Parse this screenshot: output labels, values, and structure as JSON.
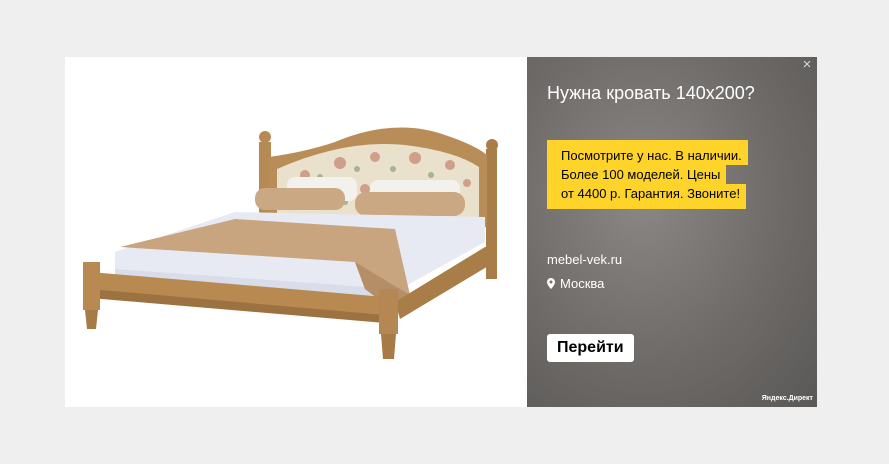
{
  "ad": {
    "title": "Нужна кровать 140х200?",
    "promo_lines": [
      "Посмотрите у нас. В наличии.",
      "Более 100 моделей. Цены",
      "от 4400 р. Гарантия. Звоните!"
    ],
    "domain": "mebel-vek.ru",
    "location": "Москва",
    "button_label": "Перейти",
    "close_label": "×",
    "brand": "Яндекс.Директ",
    "image_alt_icon": "bed-product-image",
    "colors": {
      "promo_background": "#fed42b",
      "info_panel": "#6e6b69",
      "page_background": "#efefef"
    }
  }
}
